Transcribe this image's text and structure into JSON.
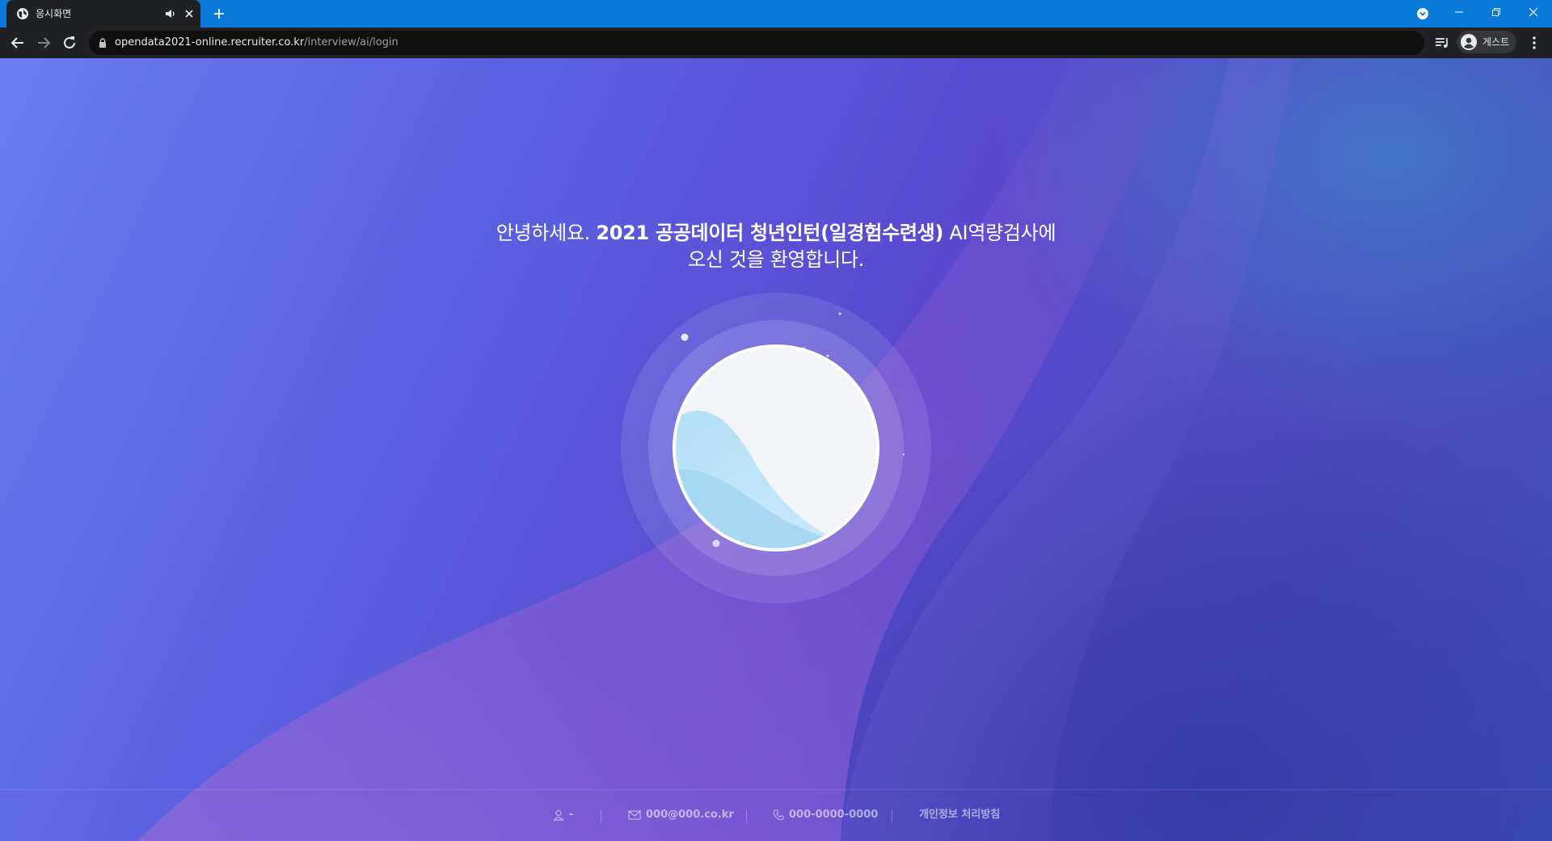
{
  "browser": {
    "tab": {
      "title": "응시화면"
    },
    "address": {
      "host": "opendata2021-online.recruiter.co.kr",
      "path": "/interview/ai/login"
    },
    "profile": {
      "label": "게스트"
    },
    "accent_color": "#0a78d7",
    "icons": [
      "globe-icon",
      "audio-icon",
      "close-icon",
      "plus-icon",
      "back-icon",
      "forward-icon",
      "reload-icon",
      "lock-icon",
      "reading-list-icon",
      "avatar-icon",
      "kebab-menu-icon",
      "minimize-icon",
      "restore-icon",
      "window-close-icon"
    ]
  },
  "main": {
    "welcome": {
      "prefix": "안녕하세요. ",
      "highlight": "2021 공공데이터 청년인턴(일경험수련생)",
      "suffix": " AI역량검사에",
      "line2": "오신 것을 환영합니다."
    }
  },
  "footer": {
    "person": "-",
    "email": "000@000.co.kr",
    "phone": "000-0000-0000",
    "privacy": "개인정보 처리방침"
  }
}
